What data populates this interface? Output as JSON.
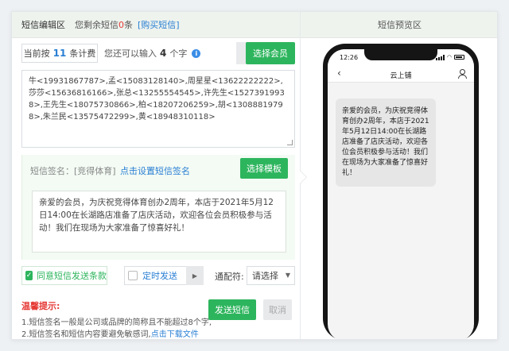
{
  "editor": {
    "title": "短信编辑区",
    "remain_prefix": "您剩余短信",
    "remain_count": "0",
    "remain_suffix": "条",
    "buy_link": "[购买短信]"
  },
  "counter": {
    "prefix": "当前按",
    "count": "11",
    "suffix": "条计费",
    "input_prefix": "您还可以输入",
    "input_count": "4",
    "input_suffix": "个字"
  },
  "buttons": {
    "select_member": "选择会员",
    "select_template": "选择模板",
    "send": "发送短信",
    "cancel": "取消"
  },
  "recipients_text": "牛<19931867787>,孟<15083128140>,周星星<13622222222>,莎莎<15636816166>,张总<13255554545>,许先生<15273919938>,王先生<18075730866>,柏<18207206259>,胡<13088819798>,朱兰民<13575472299>,黄<18948310118>",
  "signature": {
    "label": "短信签名：",
    "value": "[竞得体育]",
    "set_link": "点击设置短信签名"
  },
  "message": "亲爱的会员，为庆祝竞得体育创办2周年，本店于2021年5月12日14:00在长湖路店准备了店庆活动，欢迎各位会员积极参与活动！我们在现场为大家准备了惊喜好礼！",
  "options": {
    "agree_label": "同意短信发送条款",
    "agree_checked": true,
    "timed_label": "定时发送",
    "timed_checked": false,
    "var_label": "通配符:",
    "var_select_value": "请选择"
  },
  "tips": {
    "title": "温馨提示:",
    "line1": "1.短信签名一般是公司或品牌的简称且不能超过8个字,",
    "line2_text": "2.短信签名和短信内容要避免敏感词,",
    "line2_link": "点击下载文件"
  },
  "preview": {
    "title": "短信预览区",
    "time": "12:26",
    "app_title": "云上铺",
    "bubble": "亲爱的会员，为庆祝竞得体育创办2周年，本店于2021年5月12日14:00在长湖路店准备了店庆活动，欢迎各位会员积极参与活动！我们在现场为大家准备了惊喜好礼！"
  },
  "colors": {
    "accent_green": "#2db55d",
    "link_blue": "#2a7fd4",
    "alert_red": "#e53935"
  }
}
